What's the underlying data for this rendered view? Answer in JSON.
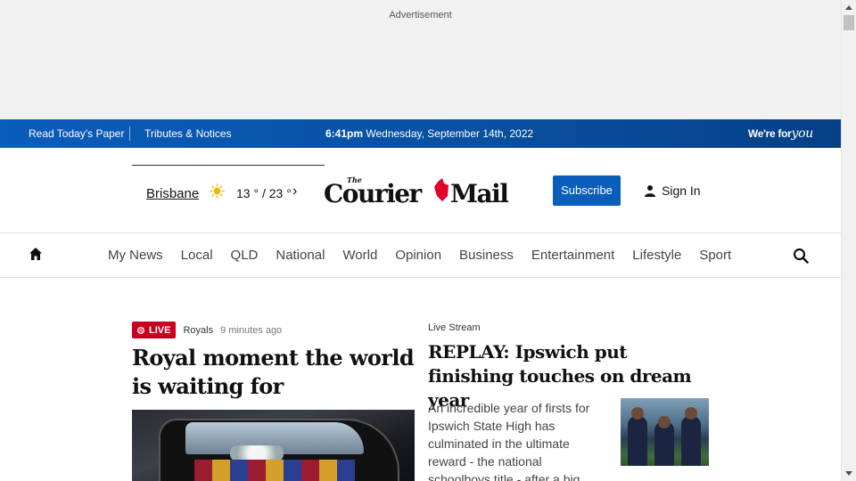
{
  "ad": {
    "label": "Advertisement"
  },
  "topbar": {
    "read_paper": "Read Today's Paper",
    "tributes": "Tributes & Notices",
    "time": "6:41pm",
    "date": "Wednesday, September 14th, 2022",
    "tagline_prefix": "We're for",
    "tagline_script": "you"
  },
  "masthead": {
    "weather": {
      "city": "Brisbane",
      "temp": "13 ° / 23 °",
      "icon": "sun-icon"
    },
    "logo": {
      "the": "The",
      "name_left": "Courier",
      "name_right": "Mail"
    },
    "subscribe": "Subscribe",
    "signin": "Sign In"
  },
  "nav": {
    "items": [
      "My News",
      "Local",
      "QLD",
      "National",
      "World",
      "Opinion",
      "Business",
      "Entertainment",
      "Lifestyle",
      "Sport"
    ]
  },
  "lead_story": {
    "badge": "LIVE",
    "category": "Royals",
    "time": "9 minutes ago",
    "headline": "Royal moment the world is waiting for"
  },
  "side_story": {
    "kicker": "Live Stream",
    "headline": "REPLAY: Ipswich put finishing touches on dream year",
    "description": "An incredible year of firsts for Ipswich State High has culminated in the ultimate reward - the national schoolboys title - after a big"
  },
  "colors": {
    "brand_blue": "#0a5dbb",
    "live_red": "#c8001e",
    "logo_red": "#e4002b"
  }
}
